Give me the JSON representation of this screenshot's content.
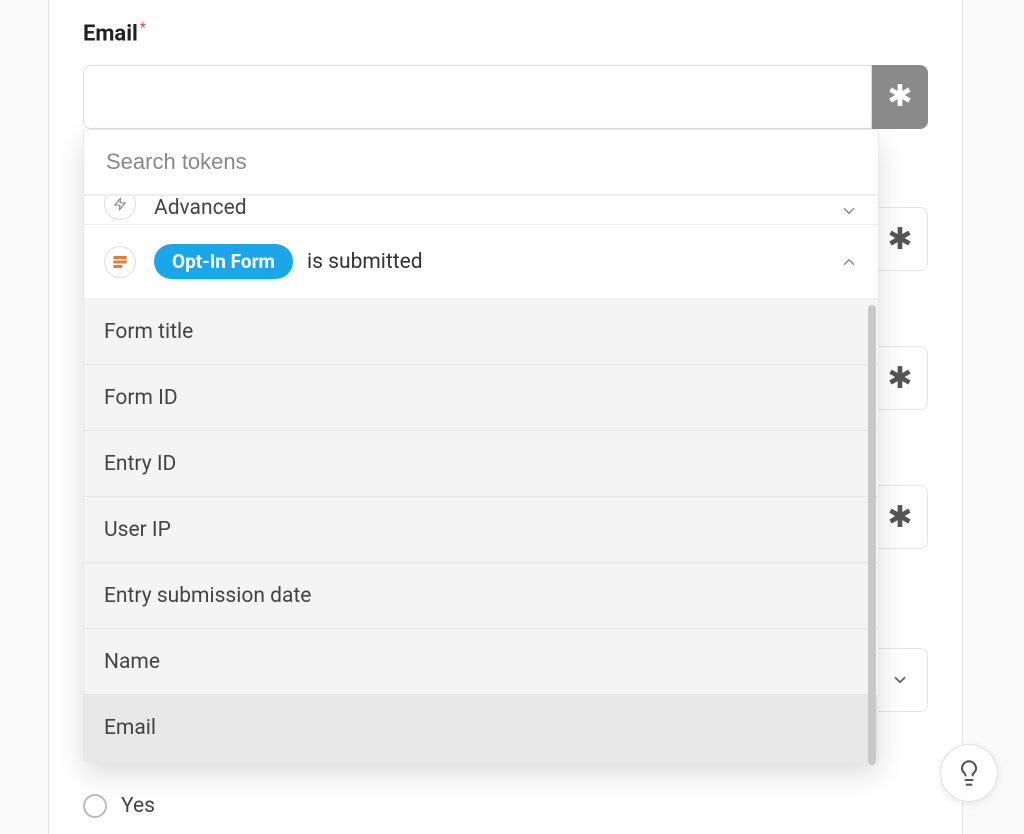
{
  "field": {
    "label": "Email",
    "required_marker": "*"
  },
  "token_button_glyph": "✱",
  "dropdown": {
    "search_placeholder": "Search tokens",
    "categories": {
      "advanced_label": "Advanced"
    },
    "trigger": {
      "pill_label": "Opt-In Form",
      "suffix_text": "is submitted"
    },
    "tokens": [
      {
        "label": "Form title"
      },
      {
        "label": "Form ID"
      },
      {
        "label": "Entry ID"
      },
      {
        "label": "User IP"
      },
      {
        "label": "Entry submission date"
      },
      {
        "label": "Name"
      },
      {
        "label": "Email"
      }
    ]
  },
  "radio": {
    "option_yes": "Yes"
  }
}
